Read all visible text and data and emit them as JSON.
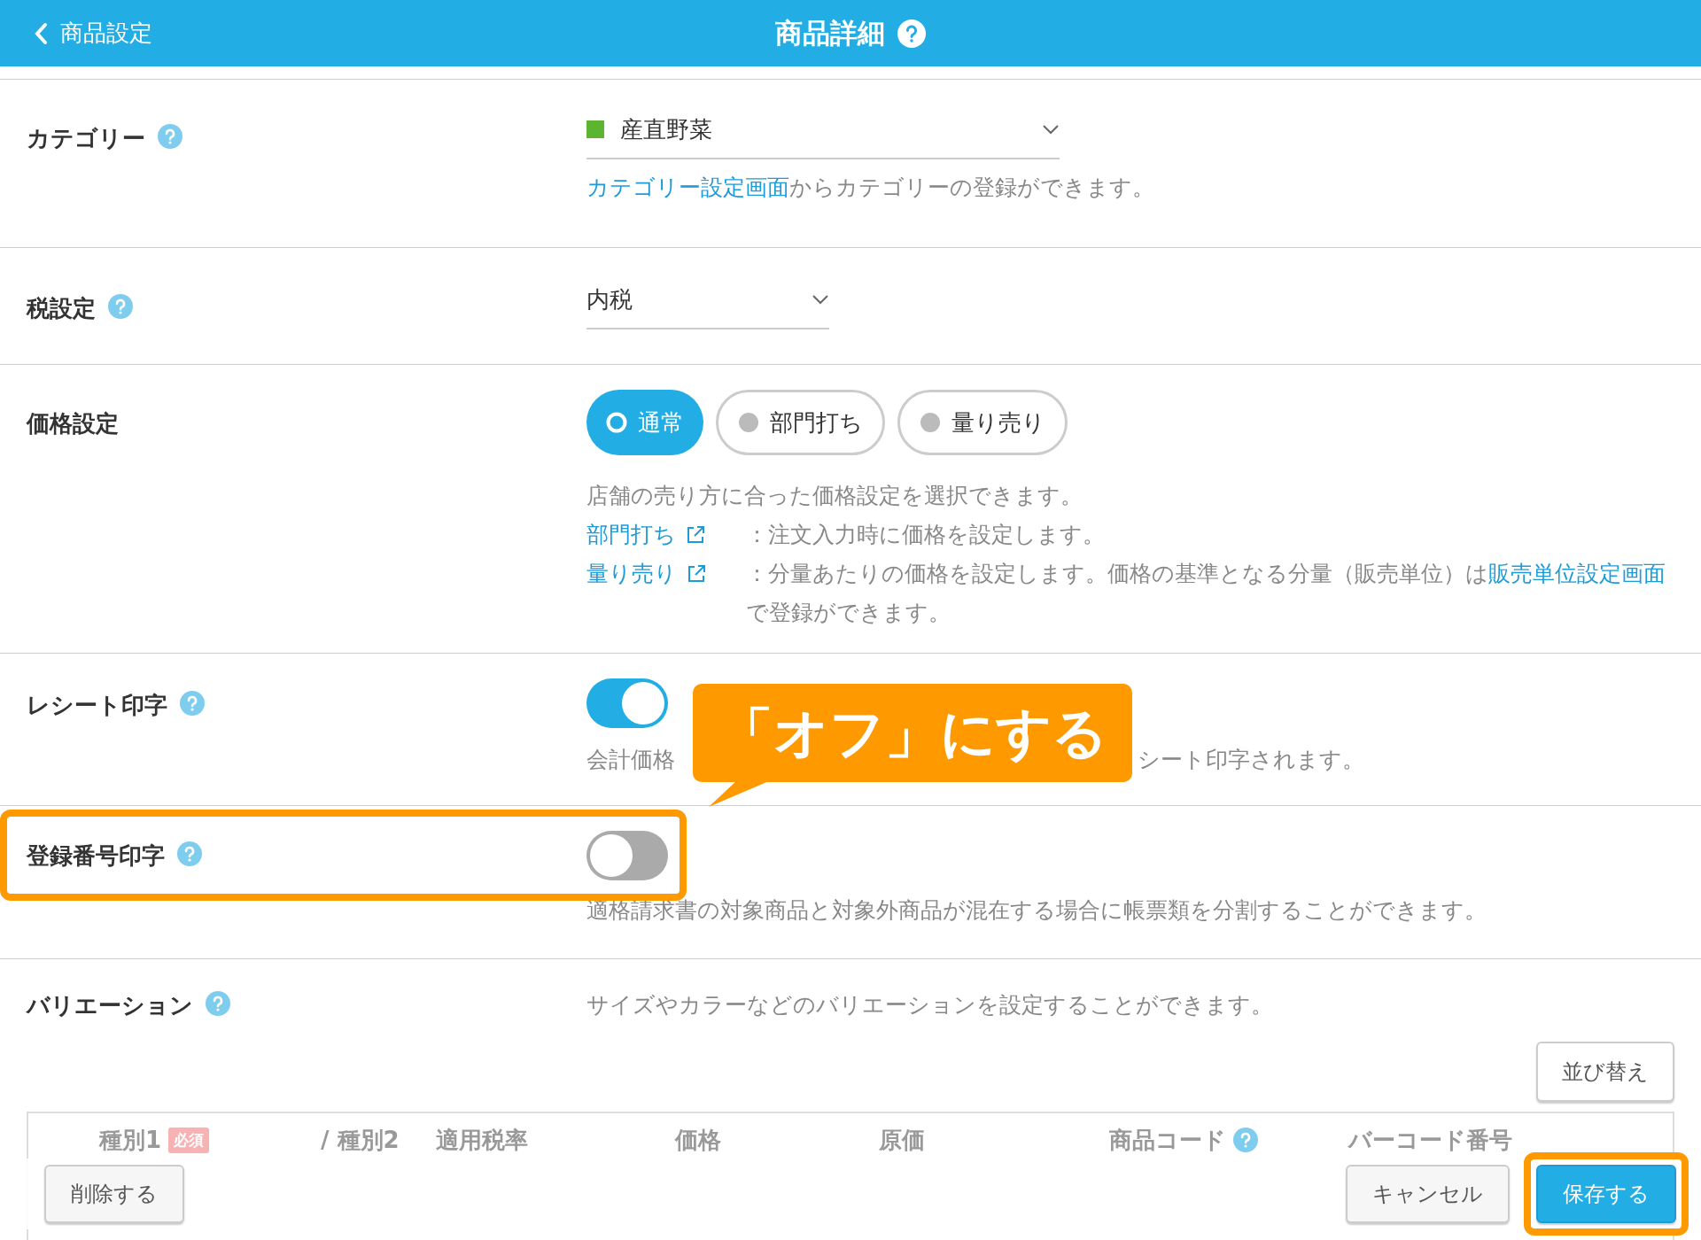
{
  "header": {
    "back_label": "商品設定",
    "title": "商品詳細"
  },
  "category": {
    "label": "カテゴリー",
    "value": "産直野菜",
    "color": "#5cb531",
    "note_link": "カテゴリー設定画面",
    "note": "からカテゴリーの登録ができます。"
  },
  "tax": {
    "label": "税設定",
    "value": "内税"
  },
  "price": {
    "label": "価格設定",
    "options": [
      {
        "label": "通常",
        "selected": true
      },
      {
        "label": "部門打ち",
        "selected": false
      },
      {
        "label": "量り売り",
        "selected": false
      }
    ],
    "description": "店舗の売り方に合った価格設定を選択できます。",
    "notes": [
      {
        "link": "部門打ち",
        "text": "：注文入力時に価格を設定します。"
      },
      {
        "link": "量り売り",
        "text": "：分量あたりの価格を設定します。価格の基準となる分量（販売単位）は",
        "text_link": "販売単位設定画面",
        "text_after": "で登録ができます。"
      }
    ]
  },
  "receipt": {
    "label": "レシート印字",
    "on": true,
    "note_start": "会計価格",
    "note_end": "シート印字されます。"
  },
  "callout": "「オフ」にする",
  "registration": {
    "label": "登録番号印字",
    "on": false,
    "highlighted": true,
    "note": "適格請求書の対象商品と対象外商品が混在する場合に帳票類を分割することができます。"
  },
  "variation": {
    "label": "バリエーション",
    "note": "サイズやカラーなどのバリエーションを設定することができます。",
    "sort_button": "並び替え",
    "columns": [
      {
        "label": "種別1",
        "badge": "必須"
      },
      {
        "label": "/ 種別2"
      },
      {
        "label": "適用税率"
      },
      {
        "label": "価格"
      },
      {
        "label": "原価"
      },
      {
        "label": "商品コード",
        "help": true
      },
      {
        "label": "バーコード番号"
      }
    ]
  },
  "footer": {
    "delete": "削除する",
    "cancel": "キャンセル",
    "save": "保存する",
    "save_highlighted": true
  }
}
